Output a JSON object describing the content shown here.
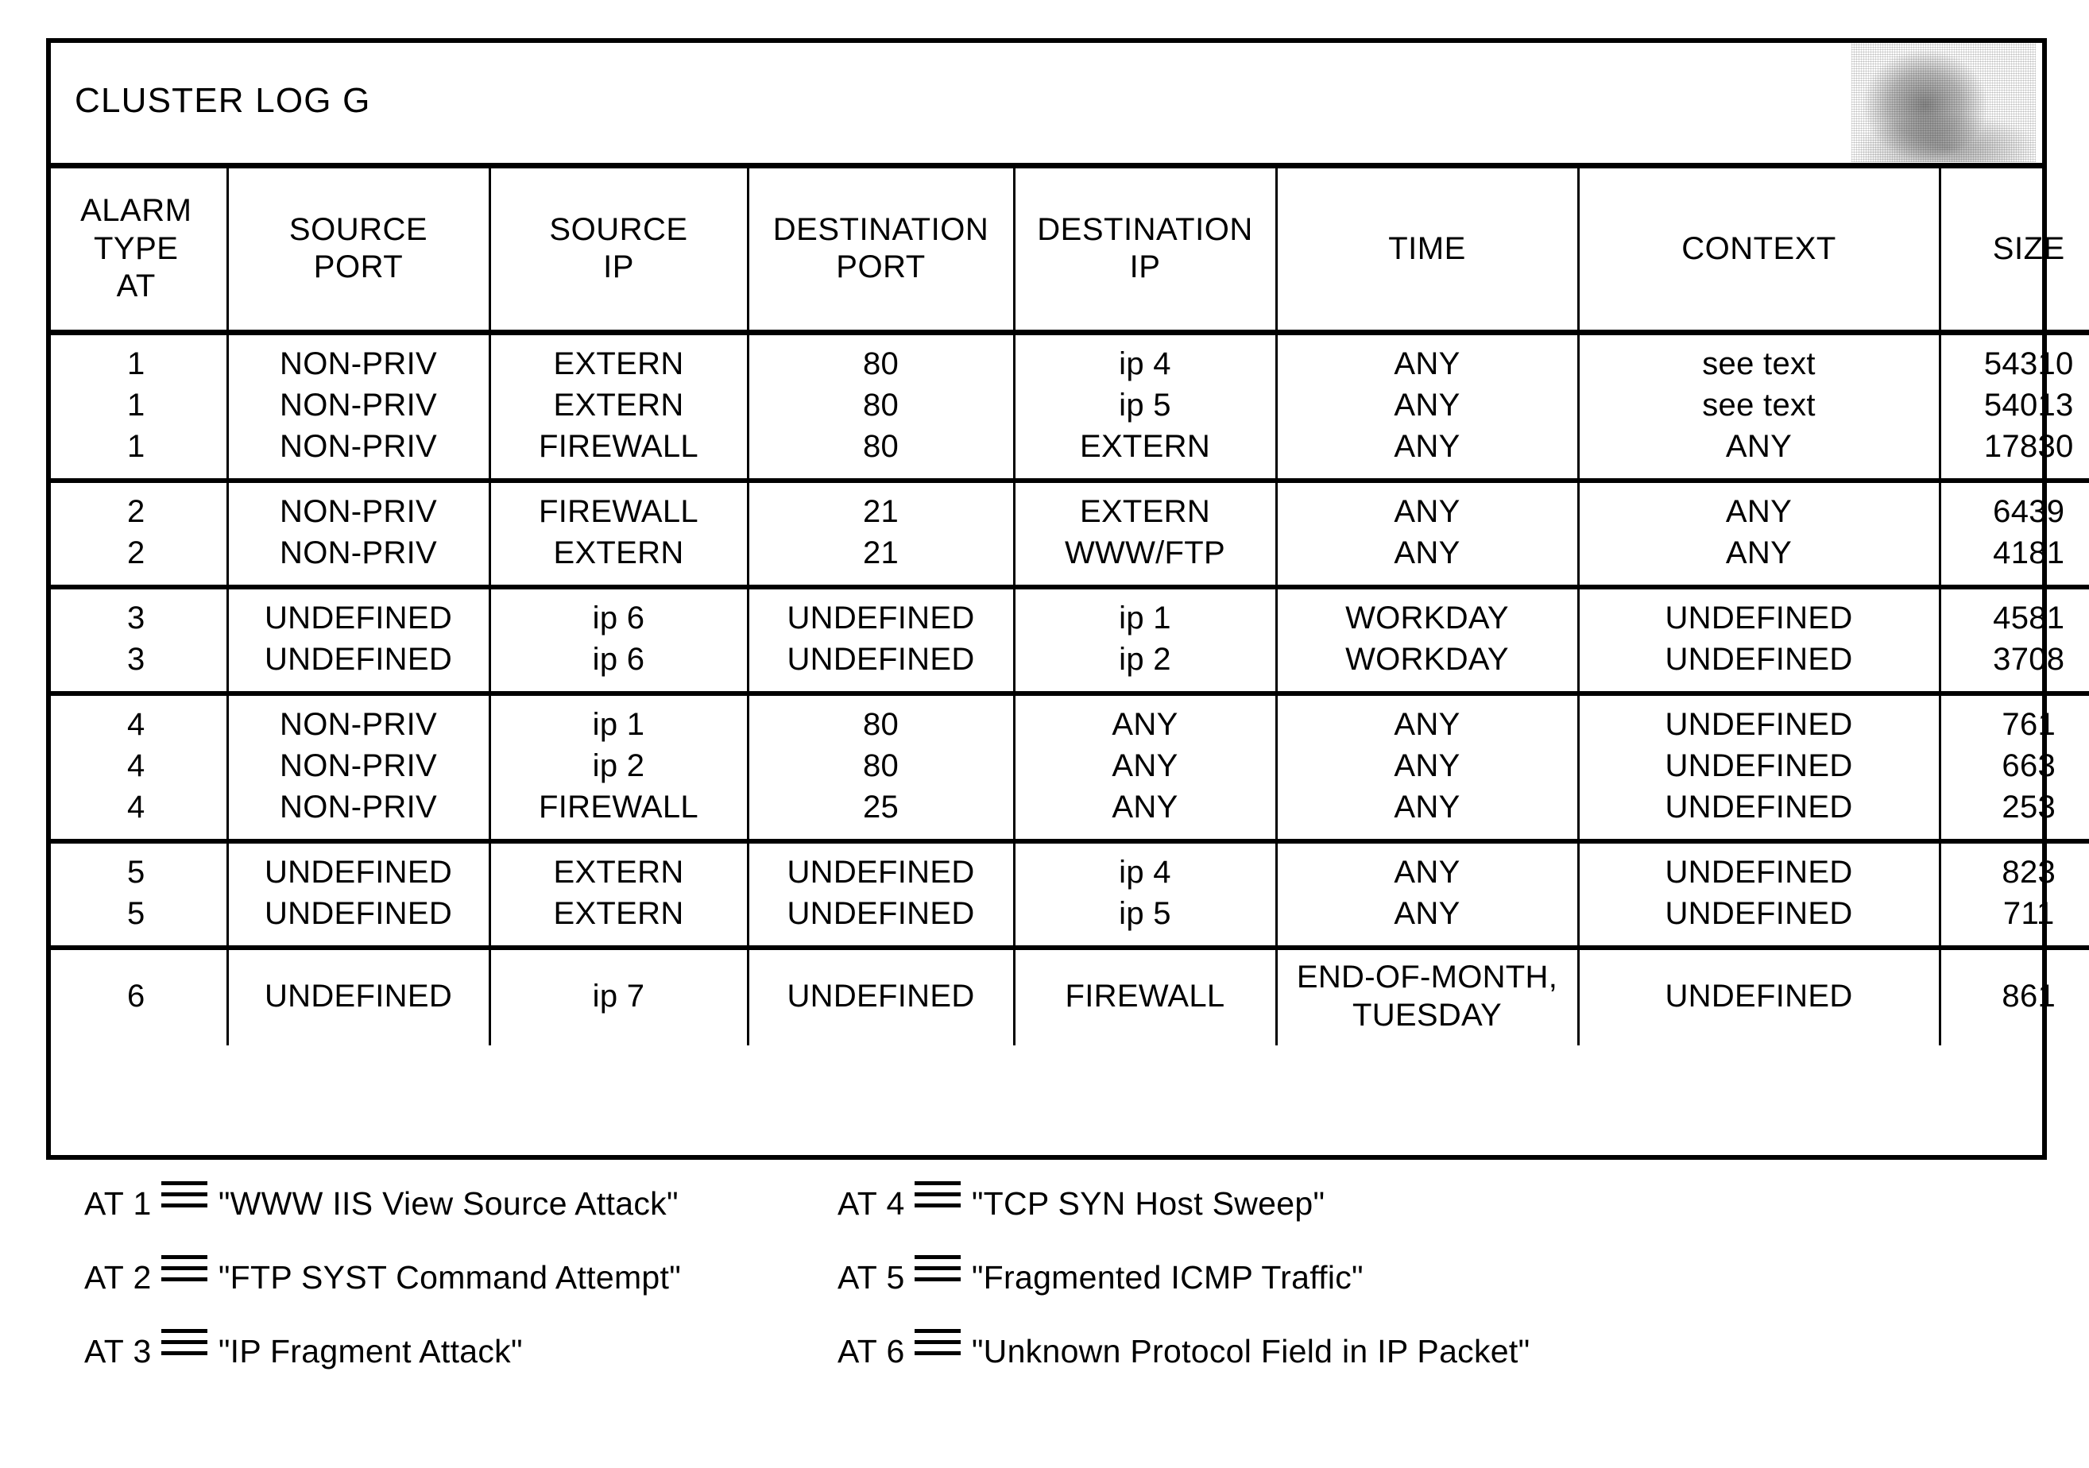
{
  "document": {
    "title": "CLUSTER LOG G"
  },
  "table": {
    "headers": [
      {
        "name": "alarm-type",
        "lines": [
          "ALARM",
          "TYPE",
          "AT"
        ]
      },
      {
        "name": "source-port",
        "lines": [
          "SOURCE",
          "PORT"
        ]
      },
      {
        "name": "source-ip",
        "lines": [
          "SOURCE",
          "IP"
        ]
      },
      {
        "name": "destination-port",
        "lines": [
          "DESTINATION",
          "PORT"
        ]
      },
      {
        "name": "destination-ip",
        "lines": [
          "DESTINATION",
          "IP"
        ]
      },
      {
        "name": "time",
        "lines": [
          "TIME"
        ]
      },
      {
        "name": "context",
        "lines": [
          "CONTEXT"
        ]
      },
      {
        "name": "size",
        "lines": [
          "SIZE"
        ]
      }
    ],
    "groups": [
      {
        "alarm_type": [
          "1",
          "1",
          "1"
        ],
        "source_port": [
          "NON-PRIV",
          "NON-PRIV",
          "NON-PRIV"
        ],
        "source_ip": [
          "EXTERN",
          "EXTERN",
          "FIREWALL"
        ],
        "destination_port": [
          "80",
          "80",
          "80"
        ],
        "destination_ip": [
          "ip 4",
          "ip 5",
          "EXTERN"
        ],
        "time": [
          "ANY",
          "ANY",
          "ANY"
        ],
        "context": [
          "see text",
          "see text",
          "ANY"
        ],
        "size": [
          "54310",
          "54013",
          "17830"
        ]
      },
      {
        "alarm_type": [
          "2",
          "2"
        ],
        "source_port": [
          "NON-PRIV",
          "NON-PRIV"
        ],
        "source_ip": [
          "FIREWALL",
          "EXTERN"
        ],
        "destination_port": [
          "21",
          "21"
        ],
        "destination_ip": [
          "EXTERN",
          "WWW/FTP"
        ],
        "time": [
          "ANY",
          "ANY"
        ],
        "context": [
          "ANY",
          "ANY"
        ],
        "size": [
          "6439",
          "4181"
        ]
      },
      {
        "alarm_type": [
          "3",
          "3"
        ],
        "source_port": [
          "UNDEFINED",
          "UNDEFINED"
        ],
        "source_ip": [
          "ip 6",
          "ip 6"
        ],
        "destination_port": [
          "UNDEFINED",
          "UNDEFINED"
        ],
        "destination_ip": [
          "ip 1",
          "ip 2"
        ],
        "time": [
          "WORKDAY",
          "WORKDAY"
        ],
        "context": [
          "UNDEFINED",
          "UNDEFINED"
        ],
        "size": [
          "4581",
          "3708"
        ]
      },
      {
        "alarm_type": [
          "4",
          "4",
          "4"
        ],
        "source_port": [
          "NON-PRIV",
          "NON-PRIV",
          "NON-PRIV"
        ],
        "source_ip": [
          "ip 1",
          "ip 2",
          "FIREWALL"
        ],
        "destination_port": [
          "80",
          "80",
          "25"
        ],
        "destination_ip": [
          "ANY",
          "ANY",
          "ANY"
        ],
        "time": [
          "ANY",
          "ANY",
          "ANY"
        ],
        "context": [
          "UNDEFINED",
          "UNDEFINED",
          "UNDEFINED"
        ],
        "size": [
          "761",
          "663",
          "253"
        ]
      },
      {
        "alarm_type": [
          "5",
          "5"
        ],
        "source_port": [
          "UNDEFINED",
          "UNDEFINED"
        ],
        "source_ip": [
          "EXTERN",
          "EXTERN"
        ],
        "destination_port": [
          "UNDEFINED",
          "UNDEFINED"
        ],
        "destination_ip": [
          "ip 4",
          "ip 5"
        ],
        "time": [
          "ANY",
          "ANY"
        ],
        "context": [
          "UNDEFINED",
          "UNDEFINED"
        ],
        "size": [
          "823",
          "711"
        ]
      },
      {
        "alarm_type": [
          "6"
        ],
        "source_port": [
          "UNDEFINED"
        ],
        "source_ip": [
          "ip 7"
        ],
        "destination_port": [
          "UNDEFINED"
        ],
        "destination_ip": [
          "FIREWALL"
        ],
        "time": [
          "END-OF-MONTH,\nTUESDAY"
        ],
        "context": [
          "UNDEFINED"
        ],
        "size": [
          "861"
        ]
      }
    ]
  },
  "legend": {
    "symbol": "identity-equivalence-icon",
    "items": [
      {
        "key": "AT 1",
        "value": "\"WWW IIS View Source Attack\""
      },
      {
        "key": "AT 4",
        "value": "\"TCP SYN Host Sweep\""
      },
      {
        "key": "AT 2",
        "value": "\"FTP SYST Command Attempt\""
      },
      {
        "key": "AT 5",
        "value": "\"Fragmented ICMP Traffic\""
      },
      {
        "key": "AT 3",
        "value": "\"IP Fragment Attack\""
      },
      {
        "key": "AT 6",
        "value": "\"Unknown Protocol Field in IP Packet\""
      }
    ]
  }
}
